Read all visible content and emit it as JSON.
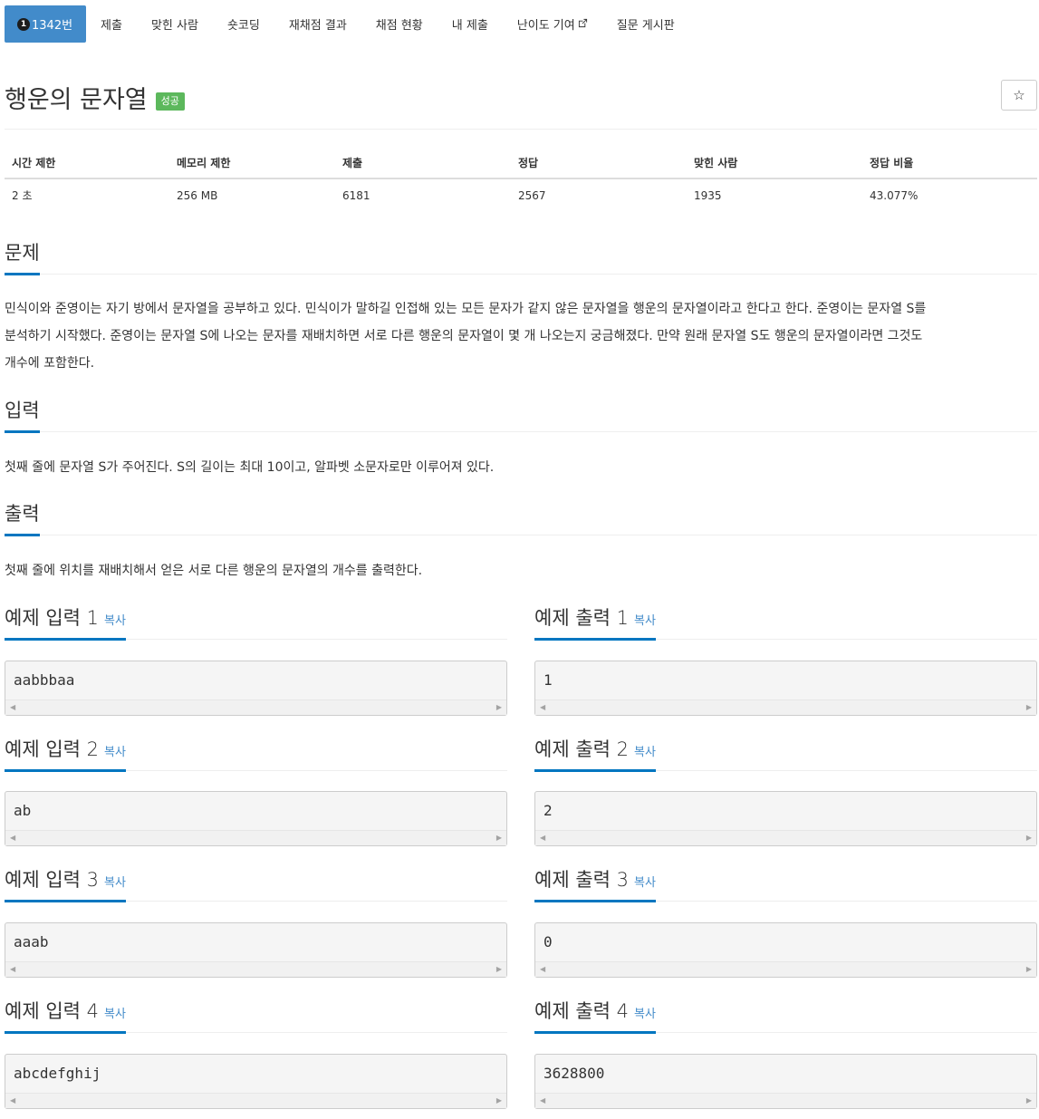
{
  "nav": {
    "items": [
      {
        "label": "1342번",
        "tier": "1",
        "active": true
      },
      {
        "label": "제출"
      },
      {
        "label": "맞힌 사람"
      },
      {
        "label": "숏코딩"
      },
      {
        "label": "재채점 결과"
      },
      {
        "label": "채점 현황"
      },
      {
        "label": "내 제출"
      },
      {
        "label": "난이도 기여",
        "icon": "external-link-icon"
      },
      {
        "label": "질문 게시판"
      }
    ]
  },
  "problem": {
    "title": "행운의 문자열",
    "status_badge": "성공",
    "star_glyph": "☆"
  },
  "info": {
    "headers": [
      "시간 제한",
      "메모리 제한",
      "제출",
      "정답",
      "맞힌 사람",
      "정답 비율"
    ],
    "values": [
      "2 초",
      "256 MB",
      "6181",
      "2567",
      "1935",
      "43.077%"
    ]
  },
  "sections": {
    "description_title": "문제",
    "description_line1": "민식이와 준영이는 자기 방에서 문자열을 공부하고 있다. 민식이가 말하길 인접해 있는 모든 문자가 같지 않은 문자열을 행운의 문자열이라고 한다고 한다. 준영이는 문자열 S를",
    "description_line2": "분석하기 시작했다. 준영이는 문자열 S에 나오는 문자를 재배치하면 서로 다른 행운의 문자열이 몇 개 나오는지 궁금해졌다. 만약 원래 문자열 S도 행운의 문자열이라면 그것도",
    "description_line3": "개수에 포함한다.",
    "input_title": "입력",
    "input_text": "첫째 줄에 문자열 S가 주어진다. S의 길이는 최대 10이고, 알파벳 소문자로만 이루어져 있다.",
    "output_title": "출력",
    "output_text": "첫째 줄에 위치를 재배치해서 얻은 서로 다른 행운의 문자열의 개수를 출력한다."
  },
  "samples": {
    "copy_label": "복사",
    "inputs": [
      {
        "title": "예제 입력 1",
        "value": "aabbbaa"
      },
      {
        "title": "예제 입력 2",
        "value": "ab"
      },
      {
        "title": "예제 입력 3",
        "value": "aaab"
      },
      {
        "title": "예제 입력 4",
        "value": "abcdefghij"
      }
    ],
    "outputs": [
      {
        "title": "예제 출력 1",
        "value": "1"
      },
      {
        "title": "예제 출력 2",
        "value": "2"
      },
      {
        "title": "예제 출력 3",
        "value": "0"
      },
      {
        "title": "예제 출력 4",
        "value": "3628800"
      }
    ]
  },
  "colors": {
    "nav_active": "#428bca",
    "badge_success": "#5cb85c",
    "heading_underline": "#0076c0",
    "link": "#428bca"
  }
}
